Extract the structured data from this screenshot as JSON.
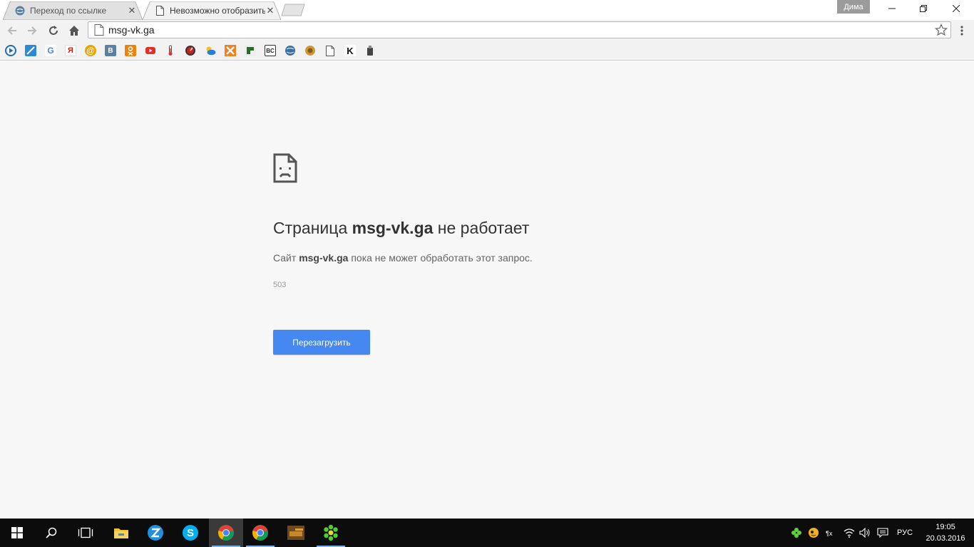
{
  "tabs": [
    {
      "title": "Переход по ссылке",
      "favicon": "vk-globe-icon",
      "active": false
    },
    {
      "title": "Невозможно отобразить",
      "favicon": "page-icon",
      "active": true
    }
  ],
  "window": {
    "profile_name": "Дима"
  },
  "toolbar": {
    "url": "msg-vk.ga"
  },
  "bookmarks": [
    {
      "icon": "play-bookmark-icon",
      "label": "",
      "color": "#1a6fc0"
    },
    {
      "icon": "zoom-bookmark-icon",
      "label": "",
      "color": "#2a8ad6"
    },
    {
      "icon": "google-bookmark-icon",
      "label": "G",
      "color": "#ffffff"
    },
    {
      "icon": "yandex-bookmark-icon",
      "label": "Я",
      "color": "#ffffff"
    },
    {
      "icon": "mail-bookmark-icon",
      "label": "@",
      "color": "#f0a000"
    },
    {
      "icon": "vk-bookmark-icon",
      "label": "B",
      "color": "#5b7fa6"
    },
    {
      "icon": "odnoklassniki-bookmark-icon",
      "label": "",
      "color": "#ee8208"
    },
    {
      "icon": "youtube-bookmark-icon",
      "label": "",
      "color": "#e52d27"
    },
    {
      "icon": "thermometer-bookmark-icon",
      "label": "",
      "color": "#ffffff"
    },
    {
      "icon": "speedometer-bookmark-icon",
      "label": "",
      "color": "#333333"
    },
    {
      "icon": "weather-bookmark-icon",
      "label": "",
      "color": "#2a7fd4"
    },
    {
      "icon": "xsolla-bookmark-icon",
      "label": "",
      "color": "#f08020"
    },
    {
      "icon": "cursor-bookmark-icon",
      "label": "",
      "color": "#2e6b2e"
    },
    {
      "icon": "bc-bookmark-icon",
      "label": "BC",
      "color": "#ffffff"
    },
    {
      "icon": "globe-bookmark-icon",
      "label": "",
      "color": "#3a6fa6"
    },
    {
      "icon": "badge-bookmark-icon",
      "label": "",
      "color": "#c89a3a"
    },
    {
      "icon": "doc-bookmark-icon",
      "label": "",
      "color": "#ffffff"
    },
    {
      "icon": "k-bookmark-icon",
      "label": "K",
      "color": "#ffffff"
    },
    {
      "icon": "tool-bookmark-icon",
      "label": "",
      "color": "#ffffff"
    }
  ],
  "error": {
    "title_prefix": "Страница",
    "domain": "msg-vk.ga",
    "title_suffix": "не работает",
    "desc_prefix": "Сайт",
    "desc_domain": "msg-vk.ga",
    "desc_suffix": "пока не может обработать этот запрос.",
    "code": "503",
    "reload_label": "Перезагрузить"
  },
  "taskbar": {
    "apps": [
      {
        "icon": "windows-start-icon"
      },
      {
        "icon": "search-icon"
      },
      {
        "icon": "task-view-icon"
      },
      {
        "icon": "file-explorer-icon"
      },
      {
        "icon": "zona-icon"
      },
      {
        "icon": "skype-icon"
      },
      {
        "icon": "chrome-icon"
      },
      {
        "icon": "chrome-icon"
      },
      {
        "icon": "tanks-game-icon"
      },
      {
        "icon": "icq-icon"
      }
    ],
    "language": "РУС",
    "time": "19:05",
    "date": "20.03.2016"
  },
  "colors": {
    "accent": "#4688f1",
    "page_bg": "#f7f7f7",
    "taskbar_bg": "#0c0c0c"
  }
}
